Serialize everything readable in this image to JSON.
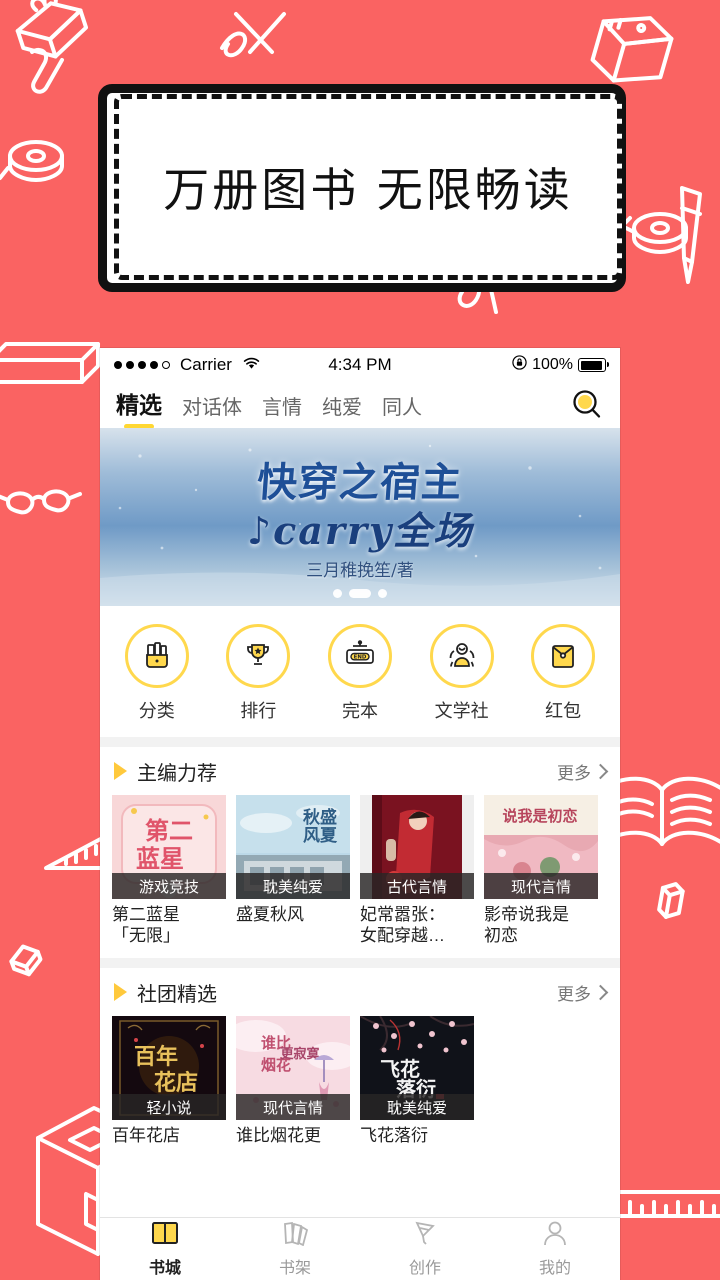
{
  "page": {
    "background_color": "#FA6362",
    "accent_yellow": "#FFD84D"
  },
  "promo": {
    "headline": "万册图书  无限畅读"
  },
  "phone": {
    "status_bar": {
      "carrier": "Carrier",
      "time": "4:34 PM",
      "battery_percent": "100%",
      "signal_dots_filled": 4,
      "signal_dots_total": 5,
      "wifi_icon": "wifi-icon",
      "lock_icon": "rotation-lock-icon",
      "battery_icon": "battery-full-icon"
    },
    "nav": {
      "tabs": [
        {
          "label": "精选",
          "active": true
        },
        {
          "label": "对话体",
          "active": false
        },
        {
          "label": "言情",
          "active": false
        },
        {
          "label": "纯爱",
          "active": false
        },
        {
          "label": "同人",
          "active": false
        }
      ],
      "search_icon": "search-icon"
    },
    "banner": {
      "title": "快穿之宿主",
      "subtitle": "♪carry全场",
      "author": "三月稚挽笙/著",
      "dots_total": 3,
      "dots_active_index": 1
    },
    "entries": [
      {
        "label": "分类",
        "icon": "book-bag-icon"
      },
      {
        "label": "排行",
        "icon": "trophy-icon"
      },
      {
        "label": "完本",
        "icon": "end-sign-icon"
      },
      {
        "label": "文学社",
        "icon": "people-group-icon"
      },
      {
        "label": "红包",
        "icon": "red-envelope-icon"
      }
    ],
    "sections": [
      {
        "title": "主编力荐",
        "more_label": "更多",
        "books": [
          {
            "name": "第二蓝星\n「无限」",
            "tag": "游戏竞技",
            "cover_style": "pink"
          },
          {
            "name": "盛夏秋风",
            "tag": "耽美纯爱",
            "cover_style": "sky"
          },
          {
            "name": "妃常嚣张：\n女配穿越…",
            "tag": "古代言情",
            "cover_style": "red"
          },
          {
            "name": "影帝说我是\n初恋",
            "tag": "现代言情",
            "cover_style": "cream"
          }
        ]
      },
      {
        "title": "社团精选",
        "more_label": "更多",
        "books": [
          {
            "name": "百年花店",
            "tag": "轻小说",
            "cover_style": "dark-gold"
          },
          {
            "name": "谁比烟花更",
            "tag": "现代言情",
            "cover_style": "blossom"
          },
          {
            "name": "飞花落衍",
            "tag": "耽美纯爱",
            "cover_style": "night-blossom"
          }
        ]
      }
    ],
    "tabbar": [
      {
        "label": "书城",
        "icon": "open-book-icon",
        "active": true
      },
      {
        "label": "书架",
        "icon": "bookshelf-icon",
        "active": false
      },
      {
        "label": "创作",
        "icon": "pen-nib-icon",
        "active": false
      },
      {
        "label": "我的",
        "icon": "user-icon",
        "active": false
      }
    ]
  }
}
